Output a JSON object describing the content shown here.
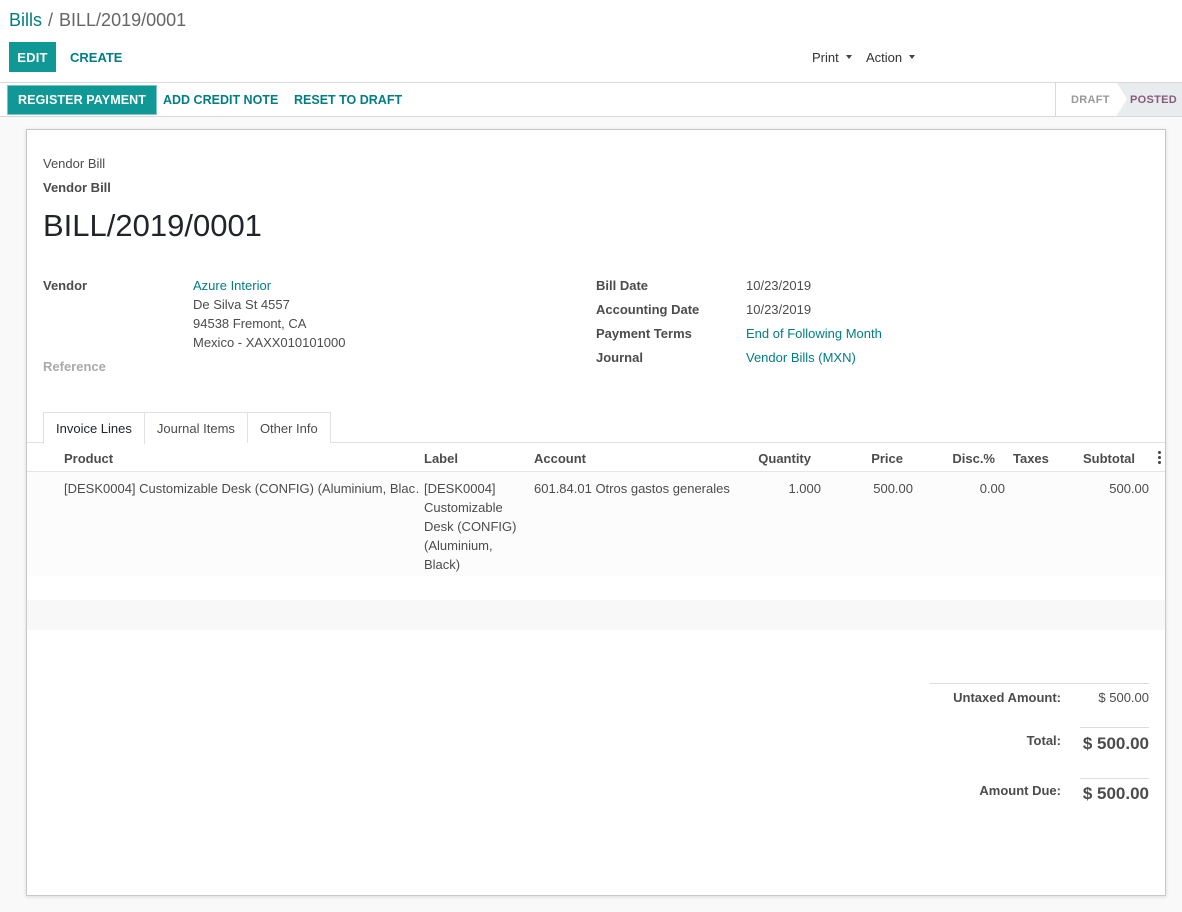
{
  "breadcrumb": {
    "parent": "Bills",
    "separator": "/",
    "current": "BILL/2019/0001"
  },
  "buttons": {
    "edit": "EDIT",
    "create": "CREATE",
    "print": "Print",
    "action": "Action"
  },
  "statusbar": {
    "register_payment": "REGISTER PAYMENT",
    "add_credit_note": "ADD CREDIT NOTE",
    "reset_to_draft": "RESET TO DRAFT",
    "states": [
      {
        "label": "DRAFT",
        "active": false
      },
      {
        "label": "POSTED",
        "active": true
      }
    ]
  },
  "document": {
    "type": "Vendor Bill",
    "type_bold": "Vendor Bill",
    "name": "BILL/2019/0001"
  },
  "left_fields": {
    "vendor_label": "Vendor",
    "vendor_name": "Azure Interior",
    "address_line1": "De Silva St 4557",
    "address_line2": "94538 Fremont, CA",
    "address_line3": "Mexico - XAXX010101000",
    "reference_label": "Reference"
  },
  "right_fields": [
    {
      "label": "Bill Date",
      "value": "10/23/2019",
      "link": false
    },
    {
      "label": "Accounting Date",
      "value": "10/23/2019",
      "link": false
    },
    {
      "label": "Payment Terms",
      "value": "End of Following Month",
      "link": true
    },
    {
      "label": "Journal",
      "value": "Vendor Bills (MXN)",
      "link": true
    }
  ],
  "tabs": [
    {
      "label": "Invoice Lines",
      "active": true
    },
    {
      "label": "Journal Items",
      "active": false
    },
    {
      "label": "Other Info",
      "active": false
    }
  ],
  "table": {
    "headers": {
      "product": "Product",
      "label": "Label",
      "account": "Account",
      "quantity": "Quantity",
      "price": "Price",
      "disc": "Disc.%",
      "taxes": "Taxes",
      "subtotal": "Subtotal"
    },
    "rows": [
      {
        "product": "[DESK0004] Customizable Desk (CONFIG) (Aluminium, Blac…",
        "label_lines": [
          "[DESK0004]",
          "Customizable",
          "Desk (CONFIG)",
          "(Aluminium,",
          "Black)"
        ],
        "account": "601.84.01 Otros gastos generales",
        "quantity": "1.000",
        "price": "500.00",
        "disc": "0.00",
        "taxes": "",
        "subtotal": "500.00"
      }
    ]
  },
  "totals": {
    "untaxed_label": "Untaxed Amount:",
    "untaxed_value": "$ 500.00",
    "total_label": "Total:",
    "total_value": "$ 500.00",
    "due_label": "Amount Due:",
    "due_value": "$ 500.00"
  },
  "colors": {
    "primary": "#0f9895",
    "link": "#017e84",
    "posted": "#875a7b"
  }
}
